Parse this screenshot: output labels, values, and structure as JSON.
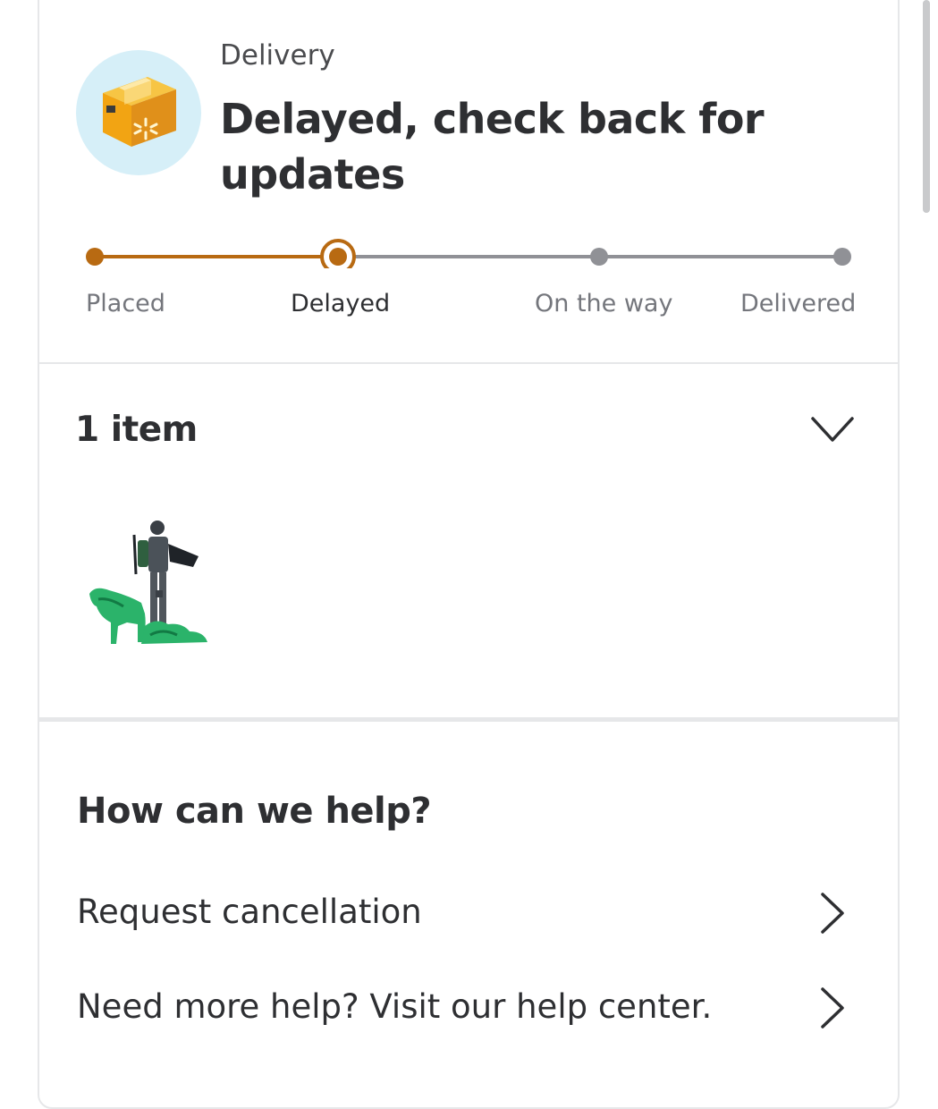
{
  "delivery": {
    "section_label": "Delivery",
    "status_title": "Delayed, check back for updates"
  },
  "progress": {
    "accent_color": "#b86a12",
    "inactive_color": "#909196",
    "current_step_index": 1,
    "steps": [
      {
        "label": "Placed"
      },
      {
        "label": "Delayed"
      },
      {
        "label": "On the way"
      },
      {
        "label": "Delivered"
      }
    ]
  },
  "items": {
    "title": "1 item"
  },
  "help": {
    "title": "How can we help?",
    "rows": [
      {
        "label": "Request cancellation"
      },
      {
        "label": "Need more help? Visit our help center."
      }
    ]
  }
}
